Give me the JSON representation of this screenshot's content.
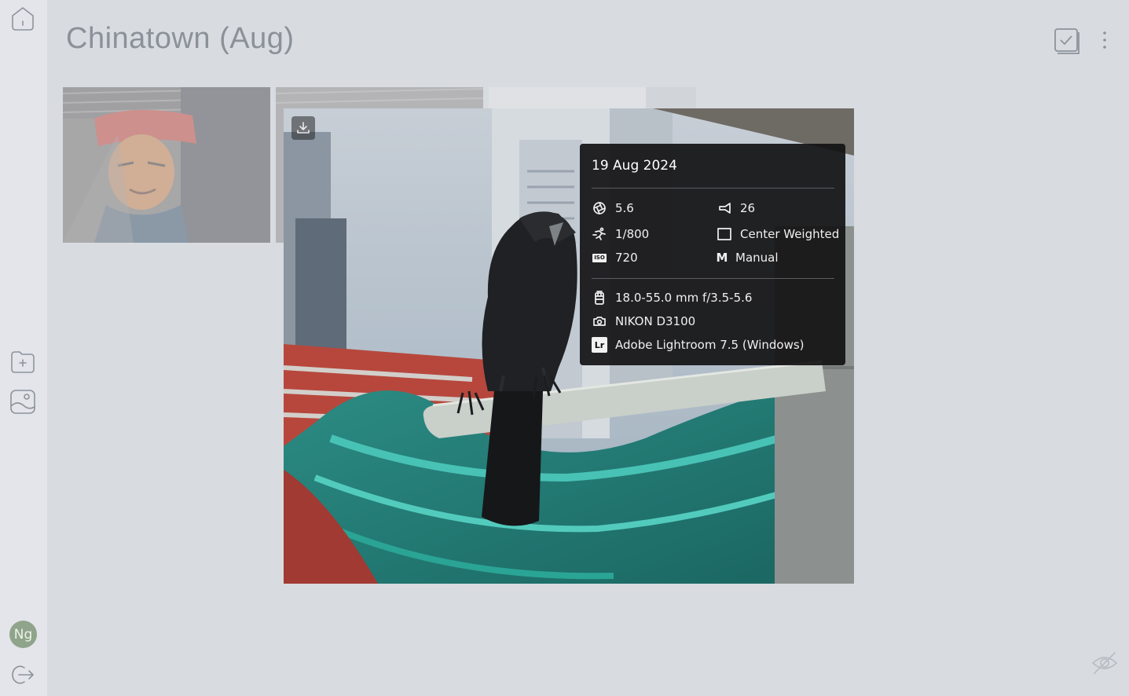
{
  "album": {
    "title": "Chinatown (Aug)"
  },
  "sidebar": {
    "avatar_initials": "Ng",
    "icons": [
      "home-icon",
      "folder-plus-icon",
      "image-plus-icon",
      "logout-icon"
    ]
  },
  "toolbar": {
    "icons": [
      "select-icon",
      "more-vertical-icon"
    ]
  },
  "info": {
    "date": "19 Aug 2024",
    "aperture": "5.6",
    "focal_length": "26",
    "shutter_speed": "1/800",
    "metering": "Center Weighted",
    "iso_badge": "ISO",
    "iso": "720",
    "mode_letter": "M",
    "mode": "Manual",
    "lens": "18.0-55.0 mm f/3.5-5.6",
    "camera": "NIKON D3100",
    "software_badge": "Lr",
    "software": "Adobe Lightroom 7.5 (Windows)"
  },
  "colors": {
    "background": "#d8dbe0",
    "sidebar": "#e3e5ea",
    "avatar": "#8fa48a",
    "panel": "#121214"
  }
}
